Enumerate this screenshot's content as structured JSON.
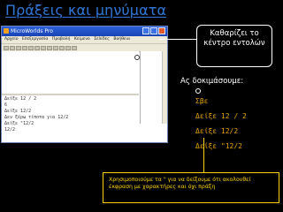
{
  "slide": {
    "title": "Πράξεις και μηνύματα",
    "callout": "Καθαρίζει το κέντρο εντολών",
    "try_label": "Ας δοκιμάσουμε:",
    "commands": [
      "Σβε",
      "Δείξε 12 / 2",
      "Δείξε 12/2",
      "Δείξε \"12/2"
    ],
    "note": "Χρησιμοποιούμε τα \" για να δείξουμε ότι ακολουθεί έκφραση με χαρακτήρες και όχι πράξη"
  },
  "app": {
    "title": "MicroWorlds Pro",
    "menu": [
      "Αρχείο",
      "Επεξεργασία",
      "Προβολή",
      "Κείμενο",
      "Σελίδες",
      "Βοήθεια"
    ],
    "command_center": [
      "Δείξε 12 / 2",
      "6",
      "Δείξε 12/2",
      "Δεν ξέρω τίποτα για 12/2",
      "Δείξε \"12/2",
      "12/2"
    ]
  }
}
